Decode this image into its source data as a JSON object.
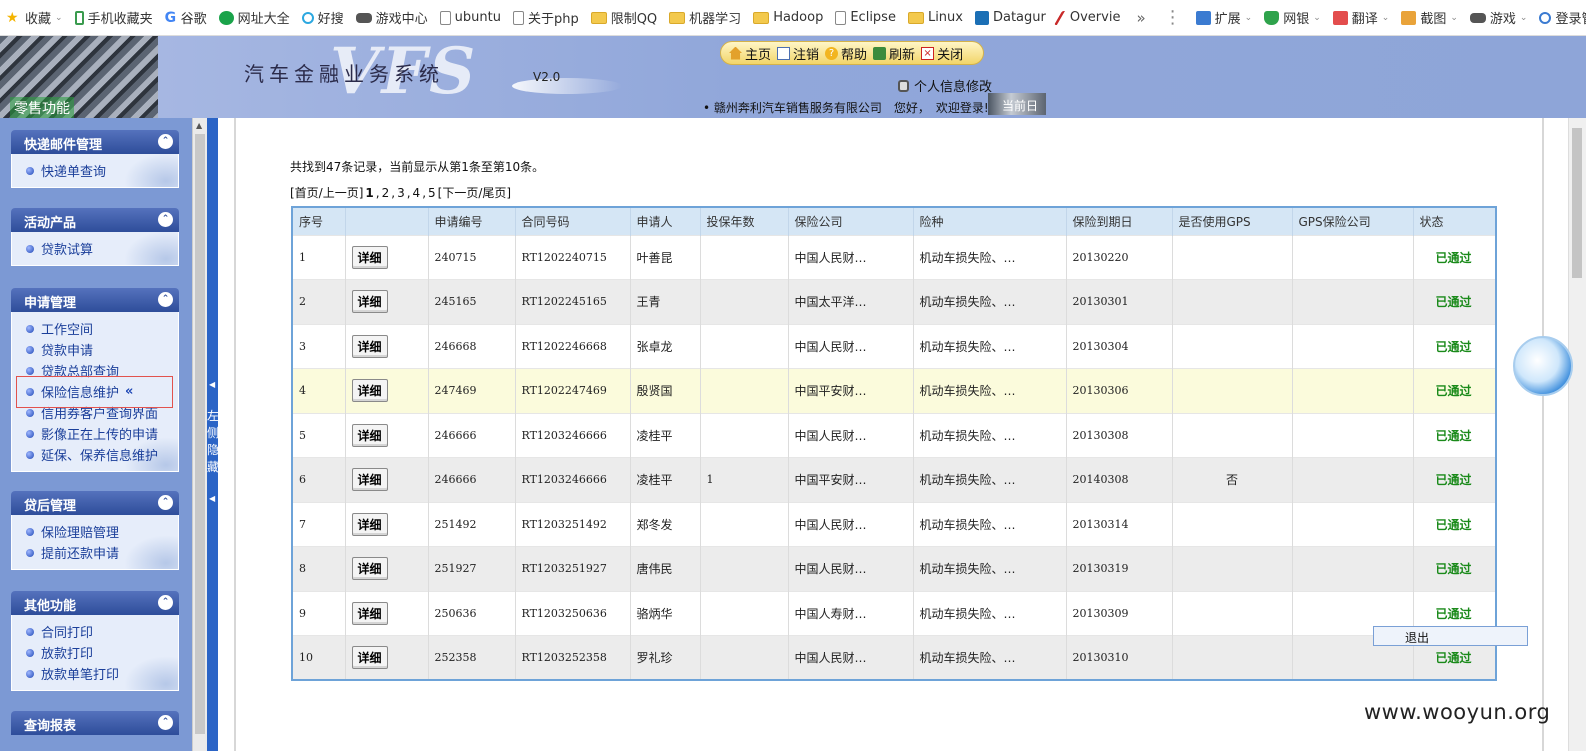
{
  "browser": {
    "bookmarks": [
      {
        "label": "收藏",
        "icon": "star-icon",
        "dropdown": true
      },
      {
        "label": "手机收藏夹",
        "icon": "phone-icon"
      },
      {
        "label": "谷歌",
        "icon": "google-icon"
      },
      {
        "label": "网址大全",
        "icon": "web-directory-icon"
      },
      {
        "label": "好搜",
        "icon": "search-engine-icon"
      },
      {
        "label": "游戏中心",
        "icon": "gamepad-icon"
      },
      {
        "label": "ubuntu",
        "icon": "page-icon"
      },
      {
        "label": "关于php",
        "icon": "page-icon"
      },
      {
        "label": "限制QQ",
        "icon": "folder-icon"
      },
      {
        "label": "机器学习",
        "icon": "folder-icon"
      },
      {
        "label": "Hadoop",
        "icon": "folder-icon"
      },
      {
        "label": "Eclipse",
        "icon": "page-icon"
      },
      {
        "label": "Linux",
        "icon": "folder-icon"
      },
      {
        "label": "Datagur",
        "icon": "chart-icon"
      },
      {
        "label": "Overvie",
        "icon": "overview-icon"
      }
    ],
    "more_symbol": "»",
    "menu_symbol": "⋮",
    "tools": [
      {
        "label": "扩展",
        "icon": "extensions-icon"
      },
      {
        "label": "网银",
        "icon": "shield-icon"
      },
      {
        "label": "翻译",
        "icon": "translate-icon"
      },
      {
        "label": "截图",
        "icon": "screenshot-icon"
      },
      {
        "label": "游戏",
        "icon": "gamepad-icon"
      },
      {
        "label": "登录管家",
        "icon": "login-manager-icon"
      }
    ]
  },
  "header": {
    "retail_label": "零售功能",
    "system_title": "汽车金融业务系统",
    "logo_text": "VFS",
    "version": "V2.0",
    "nav": [
      {
        "label": "主页",
        "icon": "home-icon"
      },
      {
        "label": "注销",
        "icon": "logout-icon"
      },
      {
        "label": "帮助",
        "icon": "help-icon"
      },
      {
        "label": "刷新",
        "icon": "refresh-icon"
      },
      {
        "label": "关闭",
        "icon": "close-icon"
      }
    ],
    "profile_link": "个人信息修改",
    "welcome": "• 赣州奔利汽车销售服务有限公司　您好，　欢迎登录!",
    "welcome_tail": "当前日期"
  },
  "sidebar": {
    "panels": [
      {
        "title": "快递邮件管理",
        "items": [
          "快递单查询"
        ]
      },
      {
        "title": "活动产品",
        "items": [
          "贷款试算"
        ]
      },
      {
        "title": "申请管理",
        "items": [
          "工作空间",
          "贷款申请",
          "贷款总部查询",
          "保险信息维护",
          "信用券客户查询界面",
          "影像正在上传的申请",
          "延保、保养信息维护"
        ],
        "active": "保险信息维护"
      },
      {
        "title": "贷后管理",
        "items": [
          "保险理赔管理",
          "提前还款申请"
        ]
      },
      {
        "title": "其他功能",
        "items": [
          "合同打印",
          "放款打印",
          "放款单笔打印"
        ]
      },
      {
        "title": "查询报表",
        "items": []
      }
    ],
    "collapse_symbol": "⌃",
    "active_marker": "«",
    "splitter_label": "左侧隐藏"
  },
  "main": {
    "summary": "共找到47条记录，当前显示从第1条至第10条。",
    "pager": {
      "first_prev": "[首页/上一页]",
      "pages": [
        "1",
        "2",
        "3",
        "4",
        "5"
      ],
      "current": "1",
      "next_last": "[下一页/尾页]"
    },
    "table": {
      "headers": [
        "序号",
        "",
        "申请编号",
        "合同号码",
        "申请人",
        "投保年数",
        "保险公司",
        "险种",
        "保险到期日",
        "是否使用GPS",
        "GPS保险公司",
        "状态"
      ],
      "detail_label": "详细",
      "rows": [
        {
          "no": "1",
          "app_no": "240715",
          "contract": "RT1202240715",
          "applicant": "叶善昆",
          "years": "",
          "insurer": "中国人民财…",
          "type": "机动车损失险、…",
          "expiry": "20130220",
          "gps": "",
          "gps_insurer": "",
          "status": "已通过"
        },
        {
          "no": "2",
          "app_no": "245165",
          "contract": "RT1202245165",
          "applicant": "王青",
          "years": "",
          "insurer": "中国太平洋…",
          "type": "机动车损失险、…",
          "expiry": "20130301",
          "gps": "",
          "gps_insurer": "",
          "status": "已通过"
        },
        {
          "no": "3",
          "app_no": "246668",
          "contract": "RT1202246668",
          "applicant": "张卓龙",
          "years": "",
          "insurer": "中国人民财…",
          "type": "机动车损失险、…",
          "expiry": "20130304",
          "gps": "",
          "gps_insurer": "",
          "status": "已通过"
        },
        {
          "no": "4",
          "app_no": "247469",
          "contract": "RT1202247469",
          "applicant": "殷贤国",
          "years": "",
          "insurer": "中国平安财…",
          "type": "机动车损失险、…",
          "expiry": "20130306",
          "gps": "",
          "gps_insurer": "",
          "status": "已通过"
        },
        {
          "no": "5",
          "app_no": "246666",
          "contract": "RT1203246666",
          "applicant": "凌桂平",
          "years": "",
          "insurer": "中国人民财…",
          "type": "机动车损失险、…",
          "expiry": "20130308",
          "gps": "",
          "gps_insurer": "",
          "status": "已通过"
        },
        {
          "no": "6",
          "app_no": "246666",
          "contract": "RT1203246666",
          "applicant": "凌桂平",
          "years": "1",
          "insurer": "中国平安财…",
          "type": "机动车损失险、…",
          "expiry": "20140308",
          "gps": "否",
          "gps_insurer": "",
          "status": "已通过"
        },
        {
          "no": "7",
          "app_no": "251492",
          "contract": "RT1203251492",
          "applicant": "郑冬发",
          "years": "",
          "insurer": "中国人民财…",
          "type": "机动车损失险、…",
          "expiry": "20130314",
          "gps": "",
          "gps_insurer": "",
          "status": "已通过"
        },
        {
          "no": "8",
          "app_no": "251927",
          "contract": "RT1203251927",
          "applicant": "唐伟民",
          "years": "",
          "insurer": "中国人民财…",
          "type": "机动车损失险、…",
          "expiry": "20130319",
          "gps": "",
          "gps_insurer": "",
          "status": "已通过"
        },
        {
          "no": "9",
          "app_no": "250636",
          "contract": "RT1203250636",
          "applicant": "骆炳华",
          "years": "",
          "insurer": "中国人寿财…",
          "type": "机动车损失险、…",
          "expiry": "20130309",
          "gps": "",
          "gps_insurer": "",
          "status": "已通过"
        },
        {
          "no": "10",
          "app_no": "252358",
          "contract": "RT1203252358",
          "applicant": "罗礼珍",
          "years": "",
          "insurer": "中国人民财…",
          "type": "机动车损失险、…",
          "expiry": "20130310",
          "gps": "",
          "gps_insurer": "",
          "status": "已通过"
        }
      ]
    }
  },
  "exit_popup": "退出",
  "watermark": "www.wooyun.org"
}
